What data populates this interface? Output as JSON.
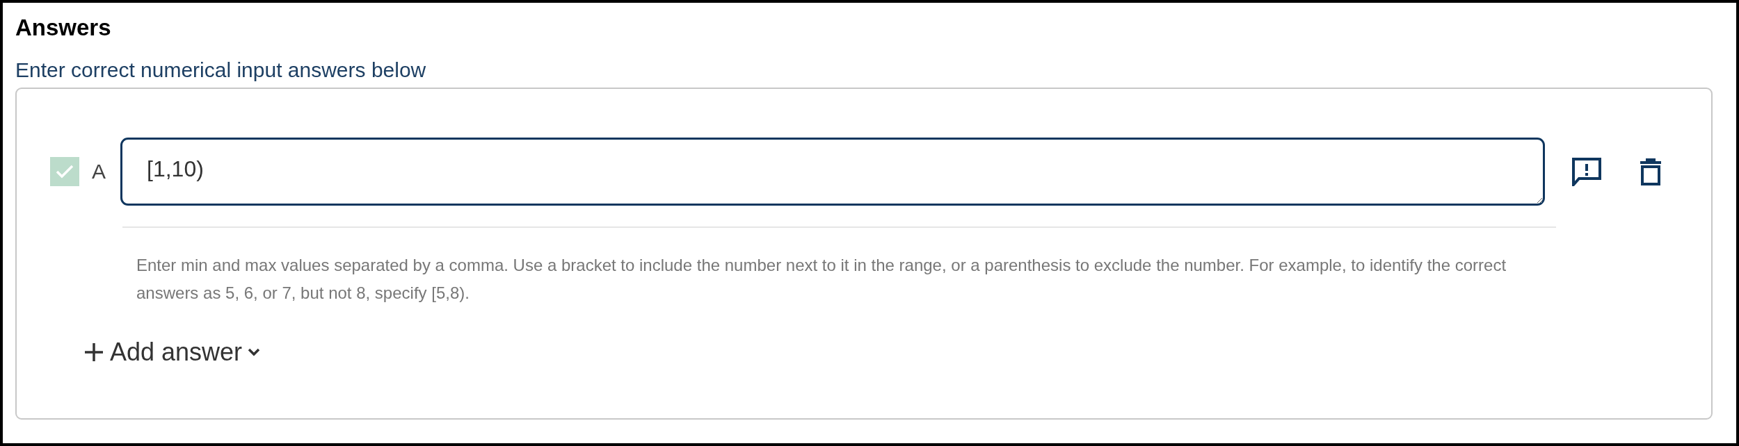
{
  "section": {
    "title": "Answers",
    "subtitle": "Enter correct numerical input answers below"
  },
  "answers": [
    {
      "label": "A",
      "checked": true,
      "value": "[1,10)"
    }
  ],
  "help_text": "Enter min and max values separated by a comma. Use a bracket to include the number next to it in the range, or a parenthesis to exclude the number. For example, to identify the correct answers as 5, 6, or 7, but not 8, specify [5,8).",
  "add_button": {
    "label": "Add answer"
  }
}
